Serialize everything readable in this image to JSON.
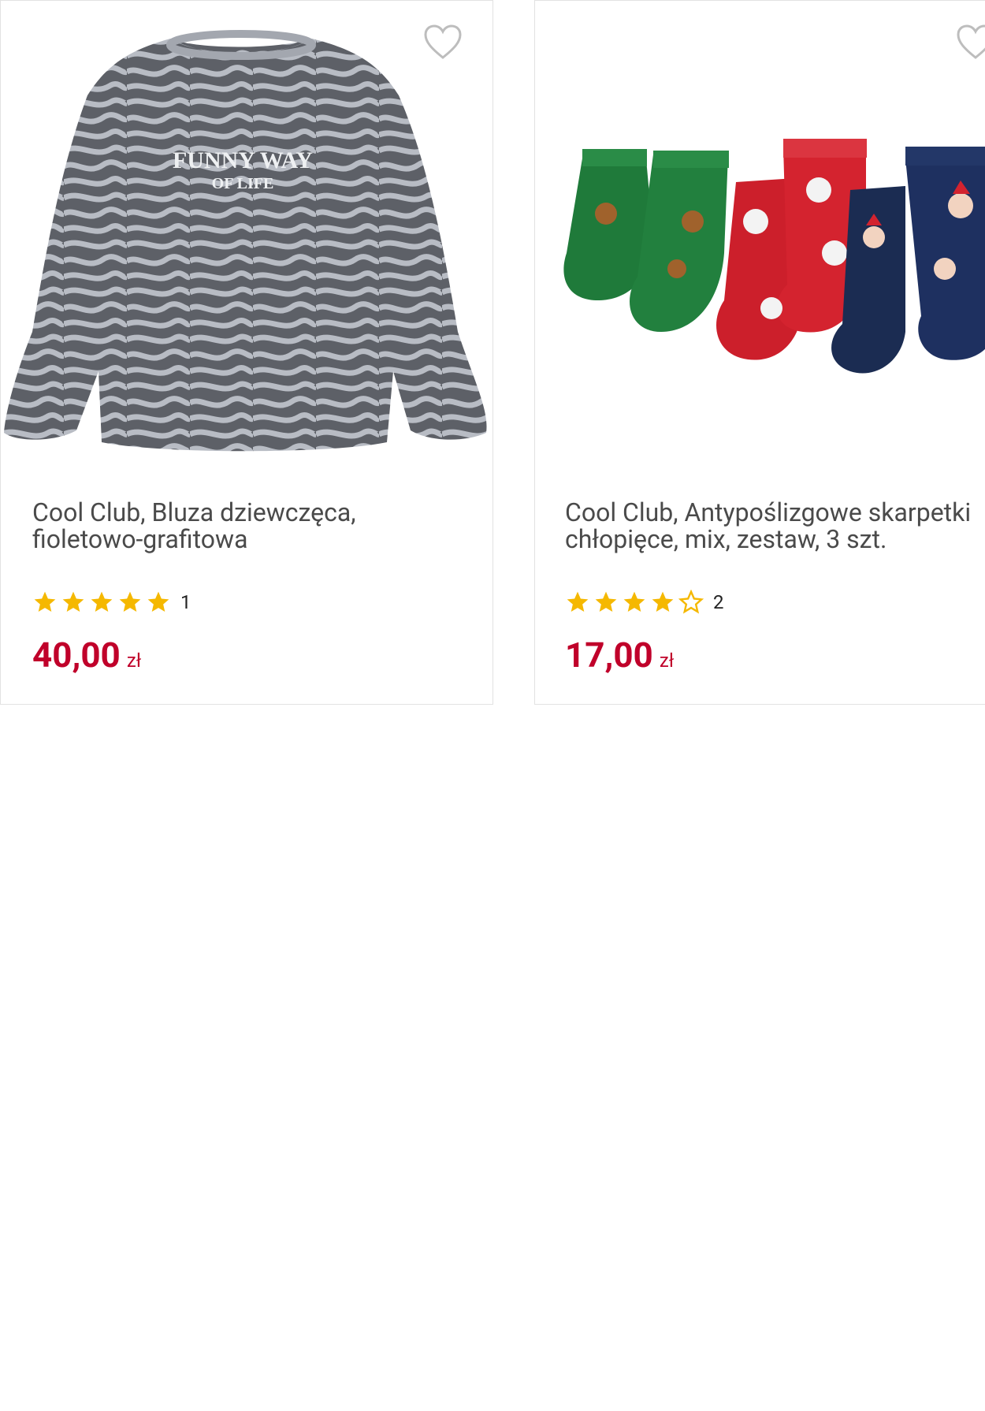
{
  "products": [
    {
      "title": "Cool Club, Bluza dziewczęca, fioletowo-grafitowa",
      "rating_count": "1",
      "rating": 5,
      "price": "40,00",
      "currency": "zł",
      "image_icon": "sweatshirt-image",
      "image_text_line1": "FUNNY WAY",
      "image_text_line2": "OF LIFE"
    },
    {
      "title": "Cool Club, Antypoślizgowe skarpetki chłopięce, mix, zestaw, 3 szt.",
      "rating_count": "2",
      "rating": 4,
      "price": "17,00",
      "currency": "zł",
      "image_icon": "socks-image"
    }
  ],
  "colors": {
    "price": "#c0002a",
    "star": "#f5b800",
    "title": "#4a4a4a",
    "border": "#e2e2e2"
  }
}
